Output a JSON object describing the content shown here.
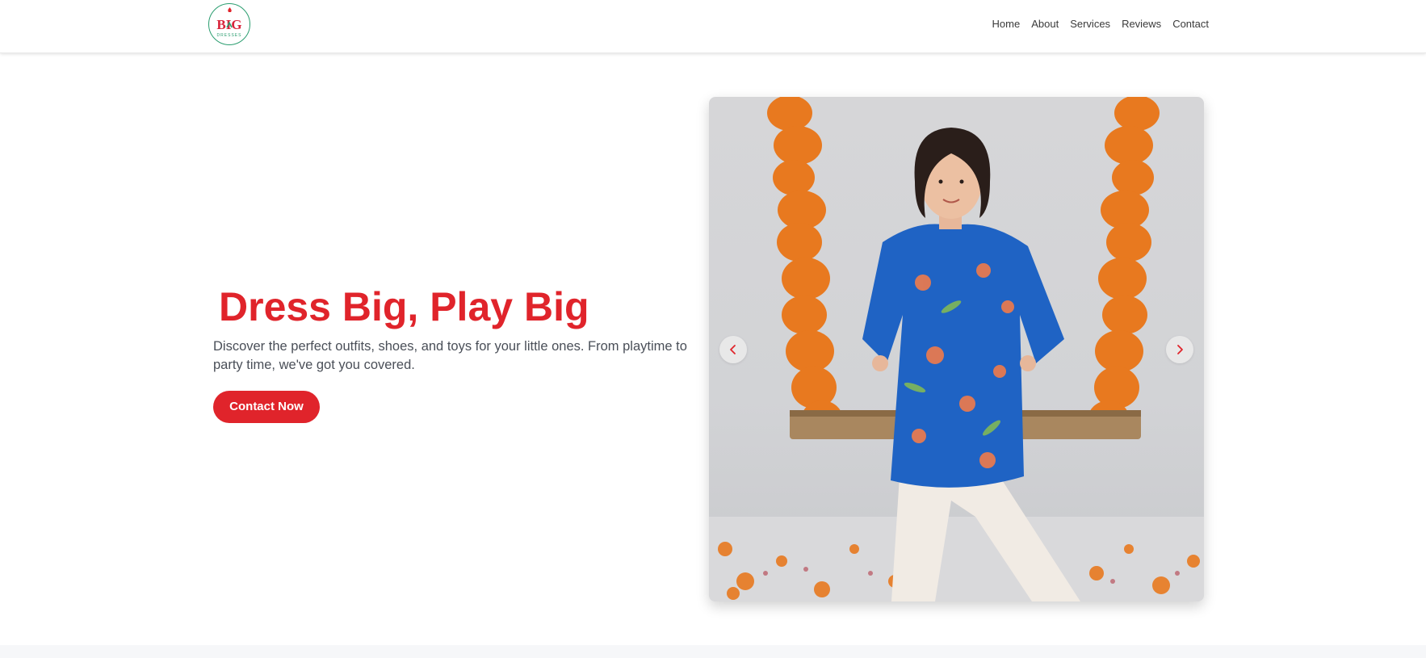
{
  "brand": {
    "logo_text": "BIG",
    "logo_sub": "DRESSES",
    "accent": "#e0242b",
    "logo_ring": "#2a9d6f"
  },
  "nav": {
    "items": [
      {
        "label": "Home"
      },
      {
        "label": "About"
      },
      {
        "label": "Services"
      },
      {
        "label": "Reviews"
      },
      {
        "label": "Contact"
      }
    ]
  },
  "hero": {
    "title": "Dress Big, Play Big",
    "description": "Discover the perfect outfits, shoes, and toys for your little ones. From playtime to party time, we've got you covered.",
    "cta_label": "Contact Now"
  },
  "carousel": {
    "image_alt": "Child in blue floral kurta standing in front of a swing decorated with marigold garlands",
    "prev_icon": "chevron-left-icon",
    "next_icon": "chevron-right-icon"
  }
}
